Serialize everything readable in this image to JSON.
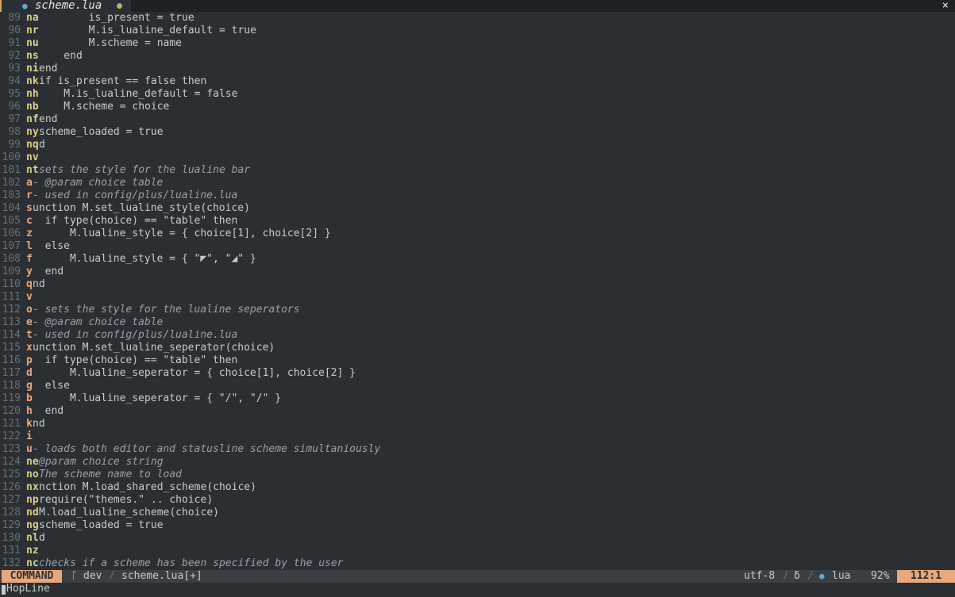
{
  "tabline": {
    "tab_name": "scheme.lua",
    "close_glyph": "×"
  },
  "lines": [
    {
      "n": "89",
      "hint": "na",
      "text": "        is_present = true"
    },
    {
      "n": "90",
      "hint": "nr",
      "text": "        M.is_lualine_default = true"
    },
    {
      "n": "91",
      "hint": "nu",
      "text": "        M.scheme = name"
    },
    {
      "n": "92",
      "hint": "ns",
      "text": "    end"
    },
    {
      "n": "93",
      "hint": "ni",
      "text": "end"
    },
    {
      "n": "94",
      "hint": "nk",
      "text": "if is_present == false then"
    },
    {
      "n": "95",
      "hint": "nh",
      "text": "    M.is_lualine_default = false"
    },
    {
      "n": "96",
      "hint": "nb",
      "text": "    M.scheme = choice"
    },
    {
      "n": "97",
      "hint": "nf",
      "text": "end"
    },
    {
      "n": "98",
      "hint": "ny",
      "text": "scheme_loaded = true"
    },
    {
      "n": "99",
      "hint": "nq",
      "text": "d"
    },
    {
      "n": "100",
      "hint": "nv",
      "text": ""
    },
    {
      "n": "101",
      "hint": "nt",
      "text": "sets the style for the lualine bar",
      "comment": true
    },
    {
      "n": "102",
      "hint": "a",
      "text": "- @param choice table",
      "comment": true
    },
    {
      "n": "103",
      "hint": "r",
      "text": "- used in config/plus/lualine.lua",
      "comment": true
    },
    {
      "n": "104",
      "hint": "s",
      "text": "unction M.set_lualine_style(choice)"
    },
    {
      "n": "105",
      "hint": "c",
      "text": "  if type(choice) == \"table\" then"
    },
    {
      "n": "106",
      "hint": "z",
      "text": "      M.lualine_style = { choice[1], choice[2] }"
    },
    {
      "n": "107",
      "hint": "l",
      "text": "  else"
    },
    {
      "n": "108",
      "hint": "f",
      "text": "      M.lualine_style = { \"◤\", \"◢\" }"
    },
    {
      "n": "109",
      "hint": "y",
      "text": "  end"
    },
    {
      "n": "110",
      "hint": "q",
      "text": "nd"
    },
    {
      "n": "111",
      "hint": "v",
      "text": ""
    },
    {
      "n": "112",
      "hint": "o",
      "text": "- sets the style for the lualine seperators",
      "comment": true
    },
    {
      "n": "113",
      "hint": "e",
      "text": "- @param choice table",
      "comment": true
    },
    {
      "n": "114",
      "hint": "t",
      "text": "- used in config/plus/lualine.lua",
      "comment": true
    },
    {
      "n": "115",
      "hint": "x",
      "text": "unction M.set_lualine_seperator(choice)"
    },
    {
      "n": "116",
      "hint": "p",
      "text": "  if type(choice) == \"table\" then"
    },
    {
      "n": "117",
      "hint": "d",
      "text": "      M.lualine_seperator = { choice[1], choice[2] }"
    },
    {
      "n": "118",
      "hint": "g",
      "text": "  else"
    },
    {
      "n": "119",
      "hint": "b",
      "text": "      M.lualine_seperator = { \"/\", \"/\" }"
    },
    {
      "n": "120",
      "hint": "h",
      "text": "  end"
    },
    {
      "n": "121",
      "hint": "k",
      "text": "nd"
    },
    {
      "n": "122",
      "hint": "i",
      "text": ""
    },
    {
      "n": "123",
      "hint": "u",
      "text": "- loads both editor and statusline scheme simultaniously",
      "comment": true
    },
    {
      "n": "124",
      "hint": "ne",
      "text": "@param choice string",
      "comment": true
    },
    {
      "n": "125",
      "hint": "no",
      "text": "The scheme name to load",
      "comment": true
    },
    {
      "n": "126",
      "hint": "nx",
      "text": "nction M.load_shared_scheme(choice)"
    },
    {
      "n": "127",
      "hint": "np",
      "text": "require(\"themes.\" .. choice)"
    },
    {
      "n": "128",
      "hint": "nd",
      "text": "M.load_lualine_scheme(choice)"
    },
    {
      "n": "129",
      "hint": "ng",
      "text": "scheme_loaded = true"
    },
    {
      "n": "130",
      "hint": "nl",
      "text": "d"
    },
    {
      "n": "131",
      "hint": "nz",
      "text": ""
    },
    {
      "n": "132",
      "hint": "nc",
      "text": "checks if a scheme has been specified by the user",
      "comment": true
    }
  ],
  "statusline": {
    "mode": "COMMAND",
    "branch_icon": "ᚴ",
    "branch": "dev",
    "sep": "/",
    "filename": "scheme.lua[+]",
    "encoding": "utf-8",
    "format_icon": "δ",
    "filetype": "lua",
    "percent": "92%",
    "position": "112:1"
  },
  "cmdline": {
    "text": "HopLine"
  },
  "colors": {
    "hint_primary": "#e8a77c",
    "hint_secondary": "#d8d08a",
    "background": "#2b2f33",
    "accent": "#e8a77c"
  }
}
